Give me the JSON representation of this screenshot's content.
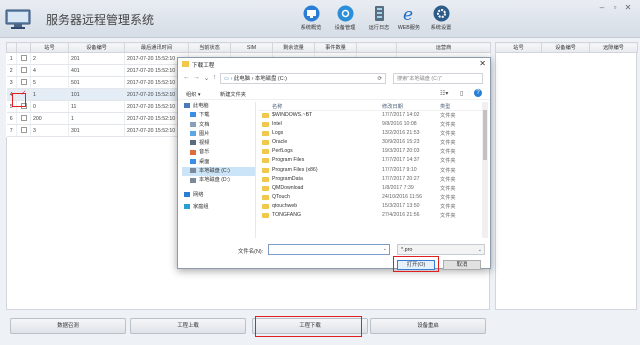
{
  "app": {
    "title": "服务器远程管理系统"
  },
  "toolbar": [
    {
      "label": "系统概览",
      "icon": "monitor-icon",
      "color": "#2a7fd4"
    },
    {
      "label": "设备管理",
      "icon": "device-icon",
      "color": "#2a8fd8"
    },
    {
      "label": "运行日志",
      "icon": "log-icon",
      "color": "#5a6c80"
    },
    {
      "label": "WEB服务",
      "icon": "web-icon",
      "color": "#1d6fc4"
    },
    {
      "label": "系统设置",
      "icon": "settings-icon",
      "color": "#2d5b8a"
    }
  ],
  "table": {
    "columns": [
      "",
      "",
      "站号",
      "设备编号",
      "最后通讯时间",
      "当前状态",
      "SIM",
      "剩余流量",
      "事件数量",
      "",
      "运营商"
    ],
    "rows": [
      {
        "idx": "1",
        "station": "2",
        "device": "201",
        "time": "2017-07-20 15:52:10"
      },
      {
        "idx": "2",
        "station": "4",
        "device": "401",
        "time": "2017-07-20 15:52:10"
      },
      {
        "idx": "3",
        "station": "5",
        "device": "501",
        "time": "2017-07-20 15:52:10"
      },
      {
        "idx": "4",
        "station": "1",
        "device": "101",
        "time": "2017-07-20 15:52:10",
        "selected": true
      },
      {
        "idx": "5",
        "station": "0",
        "device": "11",
        "time": "2017-07-20 15:52:10"
      },
      {
        "idx": "6",
        "station": "200",
        "device": "1",
        "time": "2017-07-20 15:52:10"
      },
      {
        "idx": "7",
        "station": "3",
        "device": "301",
        "time": "2017-07-20 15:52:10"
      }
    ]
  },
  "right_table": {
    "columns": [
      "站号",
      "设备编号",
      "远隙编号"
    ]
  },
  "bottom_buttons": [
    "数据召测",
    "工程上载",
    "工程下载",
    "设备重启"
  ],
  "dialog": {
    "title": "下载工程",
    "close": "✕",
    "address": [
      "此电脑",
      "本地磁盘 (C:)"
    ],
    "search_placeholder": "搜索\"本地磁盘 (C:)\"",
    "organize": "组织 ▾",
    "new_folder": "新建文件夹",
    "nav_items": [
      {
        "label": "此电脑",
        "icon": "computer-icon"
      },
      {
        "label": "下载",
        "icon": "download-folder-icon"
      },
      {
        "label": "文档",
        "icon": "documents-folder-icon"
      },
      {
        "label": "图片",
        "icon": "pictures-folder-icon"
      },
      {
        "label": "视频",
        "icon": "videos-folder-icon"
      },
      {
        "label": "音乐",
        "icon": "music-folder-icon"
      },
      {
        "label": "桌面",
        "icon": "desktop-folder-icon"
      },
      {
        "label": "本地磁盘 (C:)",
        "icon": "drive-icon",
        "selected": true
      },
      {
        "label": "本地磁盘 (D:)",
        "icon": "drive-icon"
      },
      {
        "label": "网络",
        "icon": "network-icon"
      },
      {
        "label": "家庭组",
        "icon": "homegroup-icon"
      }
    ],
    "file_headers": {
      "name": "名称",
      "date": "修改日期",
      "type": "类型"
    },
    "files": [
      {
        "name": "$WINDOWS.~BT",
        "date": "17/7/2017 14:02",
        "type": "文件夹"
      },
      {
        "name": "Intel",
        "date": "9/8/2016 10:08",
        "type": "文件夹"
      },
      {
        "name": "Logs",
        "date": "13/2/2016 21:53",
        "type": "文件夹"
      },
      {
        "name": "Oracle",
        "date": "30/9/2016 15:23",
        "type": "文件夹"
      },
      {
        "name": "PerfLogs",
        "date": "19/3/2017 20:03",
        "type": "文件夹"
      },
      {
        "name": "Program Files",
        "date": "17/7/2017 14:37",
        "type": "文件夹"
      },
      {
        "name": "Program Files (x86)",
        "date": "17/7/2017 9:10",
        "type": "文件夹"
      },
      {
        "name": "ProgramData",
        "date": "17/7/2017 20:27",
        "type": "文件夹"
      },
      {
        "name": "QMDownload",
        "date": "1/8/2017 7:39",
        "type": "文件夹"
      },
      {
        "name": "QTouch",
        "date": "24/10/2016 11:56",
        "type": "文件夹"
      },
      {
        "name": "qtouchweb",
        "date": "15/3/2017 13:50",
        "type": "文件夹"
      },
      {
        "name": "TONGFANG",
        "date": "27/4/2016 21:56",
        "type": "文件夹"
      }
    ],
    "filename_label": "文件名(N):",
    "filename_value": "",
    "filter_value": "*.pro",
    "open_button": "打开(O)",
    "cancel_button": "取消"
  },
  "colors": {
    "highlight": "#e02020",
    "selected": "#cce4f7",
    "folder": "#f2c84b"
  }
}
